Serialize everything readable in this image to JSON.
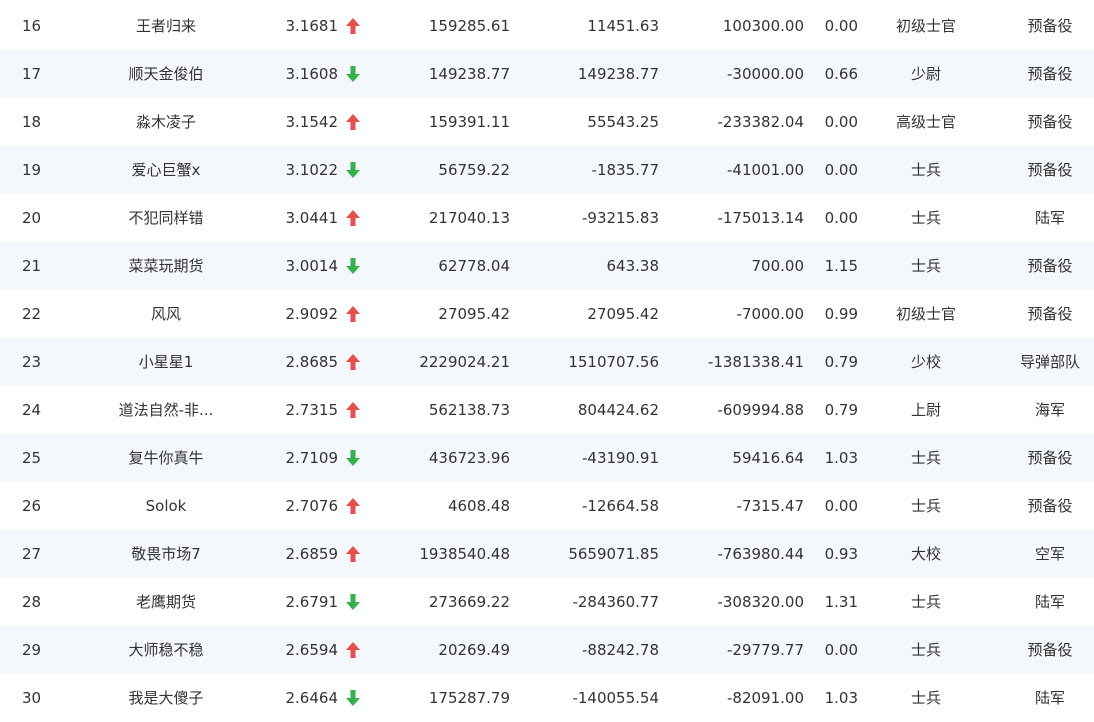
{
  "colors": {
    "up": "#e84c4c",
    "down": "#33b14a",
    "row_alt": "#f4f7fb"
  },
  "rows": [
    {
      "rank": "16",
      "name": "王者归来",
      "ratio": "3.1681",
      "trend": "up",
      "equity": "159285.61",
      "profit": "11451.63",
      "flow": "100300.00",
      "risk": "0.00",
      "military_rank": "初级士官",
      "branch": "预备役"
    },
    {
      "rank": "17",
      "name": "顺天金俊伯",
      "ratio": "3.1608",
      "trend": "down",
      "equity": "149238.77",
      "profit": "149238.77",
      "flow": "-30000.00",
      "risk": "0.66",
      "military_rank": "少尉",
      "branch": "预备役"
    },
    {
      "rank": "18",
      "name": "淼木凌子",
      "ratio": "3.1542",
      "trend": "up",
      "equity": "159391.11",
      "profit": "55543.25",
      "flow": "-233382.04",
      "risk": "0.00",
      "military_rank": "高级士官",
      "branch": "预备役"
    },
    {
      "rank": "19",
      "name": "爱心巨蟹x",
      "ratio": "3.1022",
      "trend": "down",
      "equity": "56759.22",
      "profit": "-1835.77",
      "flow": "-41001.00",
      "risk": "0.00",
      "military_rank": "士兵",
      "branch": "预备役"
    },
    {
      "rank": "20",
      "name": "不犯同样错",
      "ratio": "3.0441",
      "trend": "up",
      "equity": "217040.13",
      "profit": "-93215.83",
      "flow": "-175013.14",
      "risk": "0.00",
      "military_rank": "士兵",
      "branch": "陆军"
    },
    {
      "rank": "21",
      "name": "菜菜玩期货",
      "ratio": "3.0014",
      "trend": "down",
      "equity": "62778.04",
      "profit": "643.38",
      "flow": "700.00",
      "risk": "1.15",
      "military_rank": "士兵",
      "branch": "预备役"
    },
    {
      "rank": "22",
      "name": "风风",
      "ratio": "2.9092",
      "trend": "up",
      "equity": "27095.42",
      "profit": "27095.42",
      "flow": "-7000.00",
      "risk": "0.99",
      "military_rank": "初级士官",
      "branch": "预备役"
    },
    {
      "rank": "23",
      "name": "小星星1",
      "ratio": "2.8685",
      "trend": "up",
      "equity": "2229024.21",
      "profit": "1510707.56",
      "flow": "-1381338.41",
      "risk": "0.79",
      "military_rank": "少校",
      "branch": "导弹部队"
    },
    {
      "rank": "24",
      "name": "道法自然-非...",
      "ratio": "2.7315",
      "trend": "up",
      "equity": "562138.73",
      "profit": "804424.62",
      "flow": "-609994.88",
      "risk": "0.79",
      "military_rank": "上尉",
      "branch": "海军"
    },
    {
      "rank": "25",
      "name": "复牛你真牛",
      "ratio": "2.7109",
      "trend": "down",
      "equity": "436723.96",
      "profit": "-43190.91",
      "flow": "59416.64",
      "risk": "1.03",
      "military_rank": "士兵",
      "branch": "预备役"
    },
    {
      "rank": "26",
      "name": "Solok",
      "ratio": "2.7076",
      "trend": "up",
      "equity": "4608.48",
      "profit": "-12664.58",
      "flow": "-7315.47",
      "risk": "0.00",
      "military_rank": "士兵",
      "branch": "预备役"
    },
    {
      "rank": "27",
      "name": "敬畏市场7",
      "ratio": "2.6859",
      "trend": "up",
      "equity": "1938540.48",
      "profit": "5659071.85",
      "flow": "-763980.44",
      "risk": "0.93",
      "military_rank": "大校",
      "branch": "空军"
    },
    {
      "rank": "28",
      "name": "老鹰期货",
      "ratio": "2.6791",
      "trend": "down",
      "equity": "273669.22",
      "profit": "-284360.77",
      "flow": "-308320.00",
      "risk": "1.31",
      "military_rank": "士兵",
      "branch": "陆军"
    },
    {
      "rank": "29",
      "name": "大师稳不稳",
      "ratio": "2.6594",
      "trend": "up",
      "equity": "20269.49",
      "profit": "-88242.78",
      "flow": "-29779.77",
      "risk": "0.00",
      "military_rank": "士兵",
      "branch": "预备役"
    },
    {
      "rank": "30",
      "name": "我是大傻子",
      "ratio": "2.6464",
      "trend": "down",
      "equity": "175287.79",
      "profit": "-140055.54",
      "flow": "-82091.00",
      "risk": "1.03",
      "military_rank": "士兵",
      "branch": "陆军"
    }
  ]
}
